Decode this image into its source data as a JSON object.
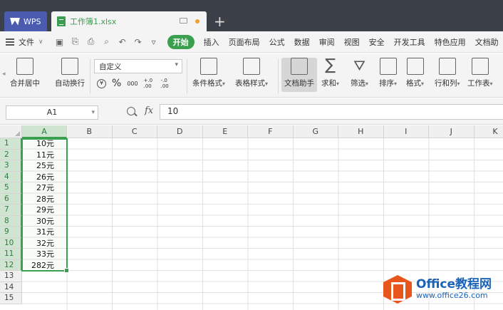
{
  "tabs": {
    "wps": "WPS",
    "document": "工作簿1.xlsx"
  },
  "menu": {
    "file": "文件",
    "start": "开始",
    "items": [
      "插入",
      "页面布局",
      "公式",
      "数据",
      "审阅",
      "视图",
      "安全",
      "开发工具",
      "特色应用",
      "文档助"
    ]
  },
  "ribbon": {
    "merge_center": "合并居中",
    "wrap_text": "自动换行",
    "number_format": "自定义",
    "percent": "%",
    "thousands": "000",
    "inc_decimal": "+.0 .00",
    "dec_decimal": "-.0 .00",
    "conditional_format": "条件格式",
    "table_style": "表格样式",
    "doc_assistant": "文档助手",
    "sum": "求和",
    "filter": "筛选",
    "sort": "排序",
    "format": "格式",
    "row_col": "行和列",
    "worksheet": "工作表"
  },
  "formula_bar": {
    "name_box": "A1",
    "fx": "fx",
    "value": "10"
  },
  "sheet": {
    "columns": [
      "A",
      "B",
      "C",
      "D",
      "E",
      "F",
      "G",
      "H",
      "I",
      "J",
      "K"
    ],
    "rows": [
      "1",
      "2",
      "3",
      "4",
      "5",
      "6",
      "7",
      "8",
      "9",
      "10",
      "11",
      "12",
      "13",
      "14",
      "15"
    ],
    "column_a": [
      "10元",
      "11元",
      "25元",
      "26元",
      "27元",
      "28元",
      "29元",
      "30元",
      "31元",
      "32元",
      "33元",
      "282元"
    ]
  },
  "watermark": {
    "title": "Office教程网",
    "url": "www.office26.com"
  },
  "colors": {
    "accent": "#3aa04f",
    "titlebar": "#3c4048",
    "wps_tab": "#4a5bb0",
    "watermark": "#e8561c"
  }
}
